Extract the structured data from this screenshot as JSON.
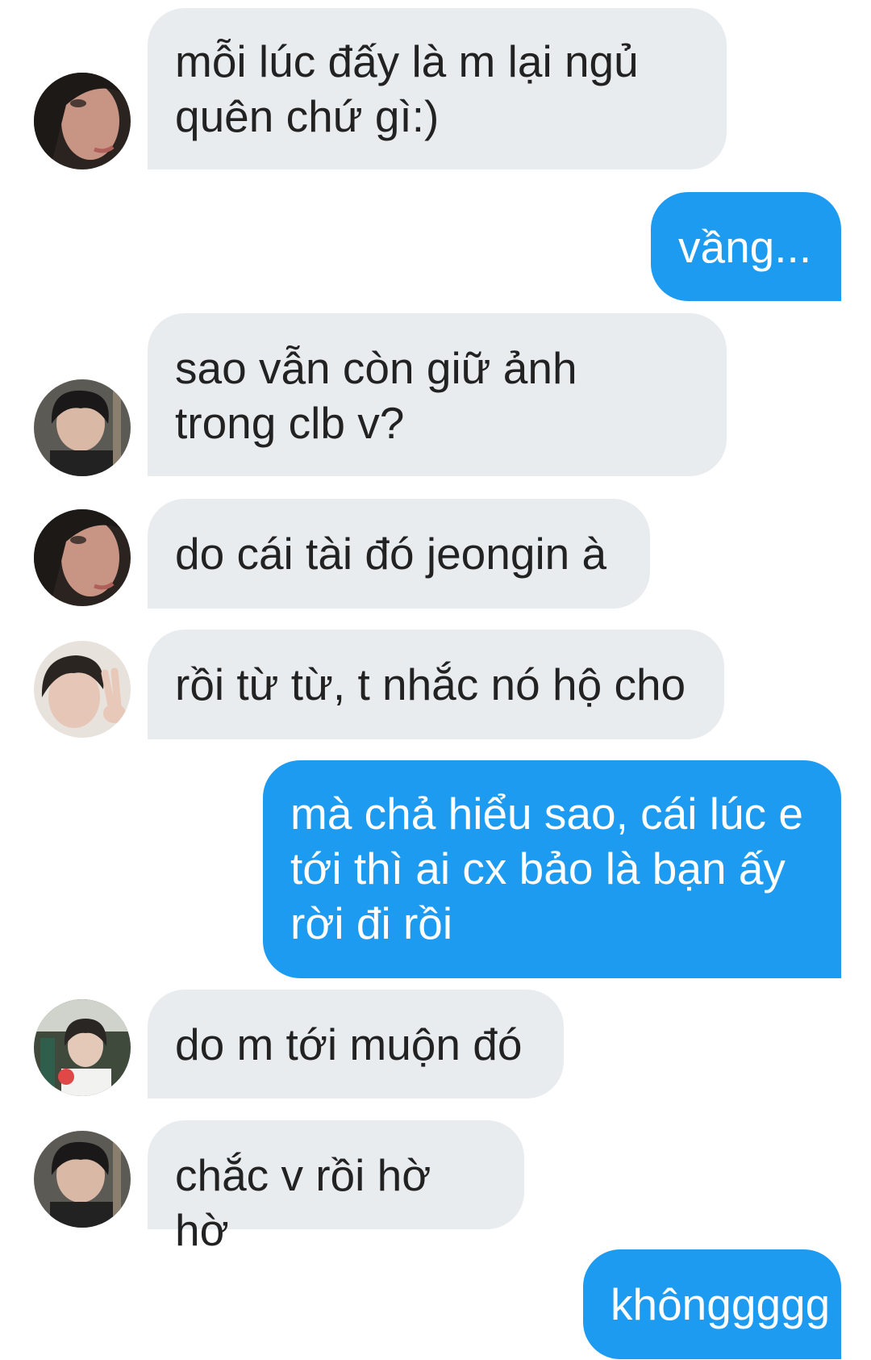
{
  "conversation": {
    "colors": {
      "incoming_bubble": "#e9ecef",
      "outgoing_bubble": "#1d9bf0",
      "incoming_text": "#222222",
      "outgoing_text": "#ffffff"
    },
    "messages": [
      {
        "side": "incoming",
        "avatar": "avatar-hooded-face-icon",
        "text": "mỗi lúc đấy là m lại ngủ\nquên chứ gì:)"
      },
      {
        "side": "outgoing",
        "text": "vầng..."
      },
      {
        "side": "incoming",
        "avatar": "avatar-dark-hair-photo-icon",
        "text": "sao vẫn còn giữ ảnh\ntrong clb v?"
      },
      {
        "side": "incoming",
        "avatar": "avatar-hooded-face-icon",
        "text": "do cái tài đó jeongin à"
      },
      {
        "side": "incoming",
        "avatar": "avatar-peace-sign-photo-icon",
        "text": "rồi từ từ, t nhắc nó hộ cho"
      },
      {
        "side": "outgoing",
        "text": "mà chả hiểu sao, cái lúc e\ntới thì ai cx bảo là bạn ấy\nrời đi rồi"
      },
      {
        "side": "incoming",
        "avatar": "avatar-train-photo-icon",
        "text": "do m tới muộn đó"
      },
      {
        "side": "incoming",
        "avatar": "avatar-dark-hair-photo-icon",
        "text": "chắc v rồi hờ hờ"
      },
      {
        "side": "outgoing",
        "text": "khônggggg"
      }
    ]
  }
}
